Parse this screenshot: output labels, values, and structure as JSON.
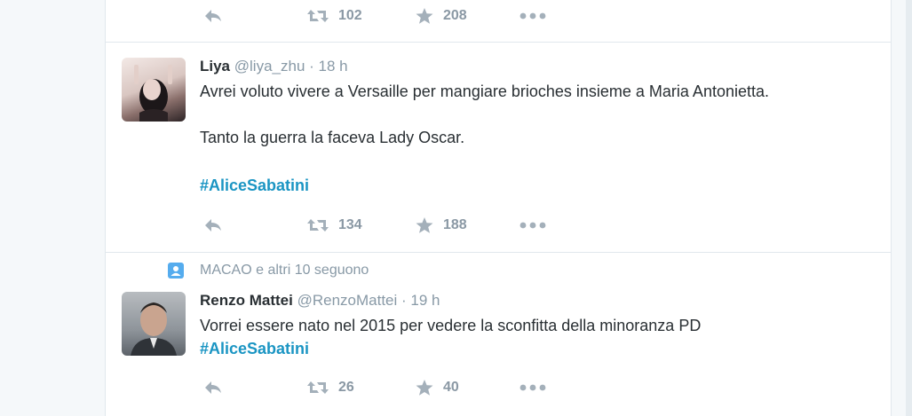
{
  "top_actions": {
    "retweet_count": "102",
    "favorite_count": "208"
  },
  "tweets": [
    {
      "fullname": "Liya",
      "username": "@liya_zhu",
      "separator": "·",
      "time": "18 h",
      "lines": [
        "Avrei voluto vivere a Versaille per mangiare brioches insieme a Maria Antonietta.",
        "Tanto la guerra la faceva Lady Oscar."
      ],
      "hashtag": "#AliceSabatini",
      "retweet_count": "134",
      "favorite_count": "188"
    },
    {
      "context": "MACAO e altri 10 seguono",
      "fullname": "Renzo Mattei",
      "username": "@RenzoMattei",
      "separator": "·",
      "time": "19 h",
      "lines": [
        "Vorrei essere nato nel 2015 per vedere la sconfitta della minoranza PD"
      ],
      "hashtag": "#AliceSabatini",
      "retweet_count": "26",
      "favorite_count": "40"
    }
  ],
  "icons": [
    "reply-icon",
    "retweet-icon",
    "favorite-icon",
    "more-icon",
    "follow-context-icon"
  ],
  "colors": {
    "hashtag": "#1b95c3",
    "muted": "#8899a6",
    "action": "#a4b0ba",
    "border": "#e1e8ed"
  }
}
